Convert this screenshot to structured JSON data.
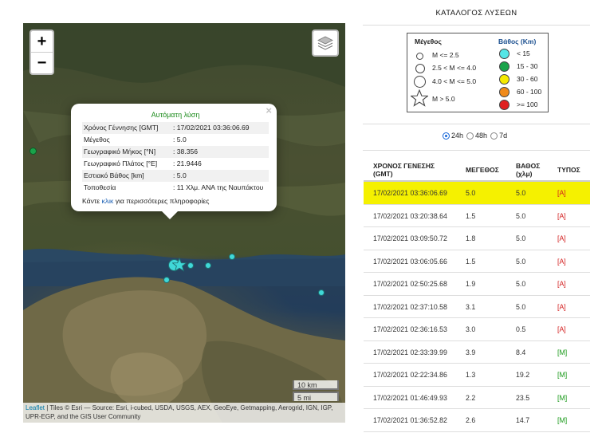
{
  "map": {
    "zoom_in": "+",
    "zoom_out": "−",
    "scale_km": "10 km",
    "scale_mi": "5 mi",
    "attribution_leaflet": "Leaflet",
    "attribution_text": " | Tiles © Esri — Source: Esri, i-cubed, USDA, USGS, AEX, GeoEye, Getmapping, Aerogrid, IGN, IGP, UPR-EGP, and the GIS User Community",
    "popup": {
      "close": "×",
      "title": "Αυτόματη λύση",
      "rows": [
        {
          "label": "Χρόνος Γέννησης [GMT]",
          "value": ": 17/02/2021 03:36:06.69"
        },
        {
          "label": "Μέγεθος",
          "value": ": 5.0"
        },
        {
          "label": "Γεωγραφικό Μήκος [°N]",
          "value": ": 38.356"
        },
        {
          "label": "Γεωγραφικό Πλάτος [°E]",
          "value": ": 21.9446"
        },
        {
          "label": "Εστιακό Βάθος [km]",
          "value": ": 5.0"
        },
        {
          "label": "Τοποθεσία",
          "value": ": 11 Χλμ. ΑΝΑ της Ναυπάκτου"
        }
      ],
      "more_prefix": "Κάντε ",
      "more_link": "κλικ",
      "more_suffix": " για περισσότερες πληροφορίες"
    }
  },
  "catalog": {
    "title": "ΚΑΤΑΛΟΓΟΣ ΛΥΣΕΩΝ",
    "legend": {
      "magnitude_header": "Μέγεθος",
      "depth_header": "Βάθος (Km)",
      "magnitude_items": [
        "M <= 2.5",
        "2.5 < M <= 4.0",
        "4.0 < M <= 5.0",
        "M > 5.0"
      ],
      "depth_items": [
        {
          "label": "< 15",
          "color": "#55e6e6"
        },
        {
          "label": "15 - 30",
          "color": "#1aa34a"
        },
        {
          "label": "30 - 60",
          "color": "#f5ea00"
        },
        {
          "label": "60 - 100",
          "color": "#f08a1a"
        },
        {
          "label": ">= 100",
          "color": "#e02020"
        }
      ]
    },
    "time_filters": [
      {
        "label": "24h",
        "selected": true
      },
      {
        "label": "48h",
        "selected": false
      },
      {
        "label": "7d",
        "selected": false
      }
    ],
    "columns": [
      "ΧΡΟΝΟΣ ΓΕΝΕΣΗΣ (GMT)",
      "ΜΕΓΕΘΟΣ",
      "ΒΑΘΟΣ (χλμ)",
      "ΤΥΠΟΣ"
    ],
    "rows": [
      {
        "time": "17/02/2021 03:36:06.69",
        "mag": "5.0",
        "depth": "5.0",
        "type": "[A]"
      },
      {
        "time": "17/02/2021 03:20:38.64",
        "mag": "1.5",
        "depth": "5.0",
        "type": "[A]"
      },
      {
        "time": "17/02/2021 03:09:50.72",
        "mag": "1.8",
        "depth": "5.0",
        "type": "[A]"
      },
      {
        "time": "17/02/2021 03:06:05.66",
        "mag": "1.5",
        "depth": "5.0",
        "type": "[A]"
      },
      {
        "time": "17/02/2021 02:50:25.68",
        "mag": "1.9",
        "depth": "5.0",
        "type": "[A]"
      },
      {
        "time": "17/02/2021 02:37:10.58",
        "mag": "3.1",
        "depth": "5.0",
        "type": "[A]"
      },
      {
        "time": "17/02/2021 02:36:16.53",
        "mag": "3.0",
        "depth": "0.5",
        "type": "[A]"
      },
      {
        "time": "17/02/2021 02:33:39.99",
        "mag": "3.9",
        "depth": "8.4",
        "type": "[M]"
      },
      {
        "time": "17/02/2021 02:22:34.86",
        "mag": "1.3",
        "depth": "19.2",
        "type": "[M]"
      },
      {
        "time": "17/02/2021 01:46:49.93",
        "mag": "2.2",
        "depth": "23.5",
        "type": "[M]"
      },
      {
        "time": "17/02/2021 01:36:52.82",
        "mag": "2.6",
        "depth": "14.7",
        "type": "[M]"
      }
    ]
  }
}
